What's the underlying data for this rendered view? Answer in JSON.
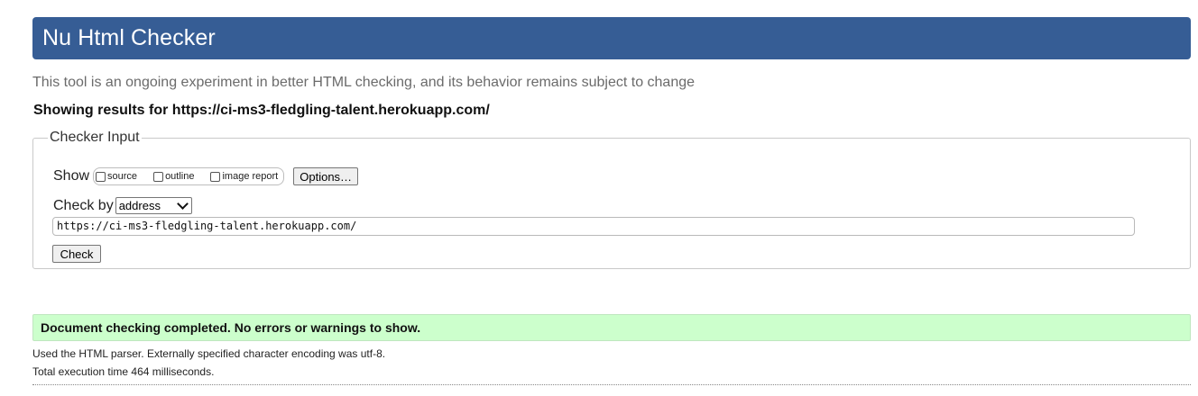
{
  "header": {
    "title": "Nu Html Checker"
  },
  "tagline": "This tool is an ongoing experiment in better HTML checking, and its behavior remains subject to change",
  "results_for": "Showing results for https://ci-ms3-fledgling-talent.herokuapp.com/",
  "checker_input": {
    "legend": "Checker Input",
    "show_label": "Show",
    "options": [
      {
        "label": "source",
        "checked": false
      },
      {
        "label": "outline",
        "checked": false
      },
      {
        "label": "image report",
        "checked": false
      }
    ],
    "options_button": "Options…",
    "check_by_label": "Check by",
    "check_by_value": "address",
    "url_value": "https://ci-ms3-fledgling-talent.herokuapp.com/",
    "check_button": "Check"
  },
  "result": {
    "message": "Document checking completed. No errors or warnings to show.",
    "parser_info": "Used the HTML parser. Externally specified character encoding was utf-8.",
    "timing": "Total execution time 464 milliseconds."
  },
  "colors": {
    "header_bg": "#365d95",
    "success_bg": "#ccffcc"
  }
}
